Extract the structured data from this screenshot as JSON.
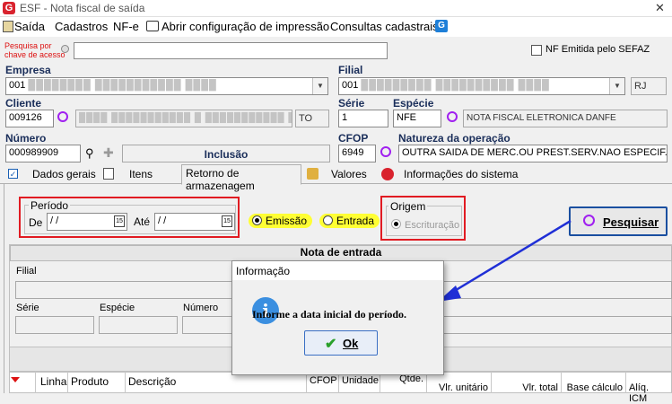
{
  "window": {
    "title": "ESF - Nota fiscal de saída",
    "close": "✕"
  },
  "menu": [
    {
      "label": "Saída",
      "icon": "exit-icon"
    },
    {
      "label": "Cadastros"
    },
    {
      "label": "NF-e"
    },
    {
      "label": "Abrir configuração de impressão",
      "icon": "printer-icon"
    },
    {
      "label": "Consultas cadastrais"
    }
  ],
  "search": {
    "label_line1": "Pesquisa por",
    "label_line2": "chave de acesso",
    "value": ""
  },
  "sefaz_checkbox": {
    "label": "NF Emitida pelo SEFAZ",
    "checked": false
  },
  "empresa": {
    "label": "Empresa",
    "code": "001",
    "name": "████████ ███████████ ████",
    "blurred": true
  },
  "filial": {
    "label": "Filial",
    "code": "001",
    "name": "█████████ ██████████ ████",
    "uf": "RJ",
    "blurred": true
  },
  "cliente": {
    "label": "Cliente",
    "code": "009126",
    "name": "████ ███████████ █ ███████████ ██ ████",
    "uf": "TO",
    "blurred": true
  },
  "serie": {
    "label": "Série",
    "value": "1"
  },
  "especie": {
    "label": "Espécie",
    "code": "NFE",
    "desc": "NOTA FISCAL ELETRONICA DANFE"
  },
  "numero": {
    "label": "Número",
    "value": "000989909",
    "status": "Inclusão"
  },
  "cfop": {
    "label": "CFOP",
    "value": "6949"
  },
  "natureza": {
    "label": "Natureza da operação",
    "value": "OUTRA SAIDA DE MERC.OU PREST.SERV.NAO ESPECIF."
  },
  "tabs": [
    {
      "label": "Dados gerais",
      "active": false
    },
    {
      "label": "Itens",
      "active": false
    },
    {
      "label": "Retorno de armazenagem",
      "active": true
    },
    {
      "label": "Valores",
      "active": false
    },
    {
      "label": "Informações do sistema",
      "active": false
    }
  ],
  "periodo": {
    "title": "Período",
    "de_label": "De",
    "de_value": "/ /",
    "ate_label": "Até",
    "ate_value": "/ /"
  },
  "radios": {
    "emissao": "Emissão",
    "entrada": "Entrada",
    "selected": "emissao"
  },
  "origem": {
    "title": "Origem",
    "escrituracao": "Escrituração"
  },
  "pesquisar_button": "Pesquisar",
  "nota_entrada": {
    "title": "Nota de entrada",
    "filial_label": "Filial",
    "serie_label": "Série",
    "especie_label": "Espécie",
    "numero_label": "Número"
  },
  "grid_columns": [
    "Linha",
    "Produto",
    "Descrição",
    "CFOP",
    "Unidade",
    "Qtde.",
    "Vlr. unitário",
    "Vlr. total",
    "Base cálculo",
    "Alíq. ICM"
  ],
  "dialog": {
    "title": "Informação",
    "message": "Informe a data inicial do período.",
    "ok": "Ok"
  },
  "colors": {
    "accent_red": "#e11b22",
    "highlight_yellow": "#ffff33",
    "arrow_blue": "#1f2fd6",
    "info_blue": "#3b8fe0"
  }
}
